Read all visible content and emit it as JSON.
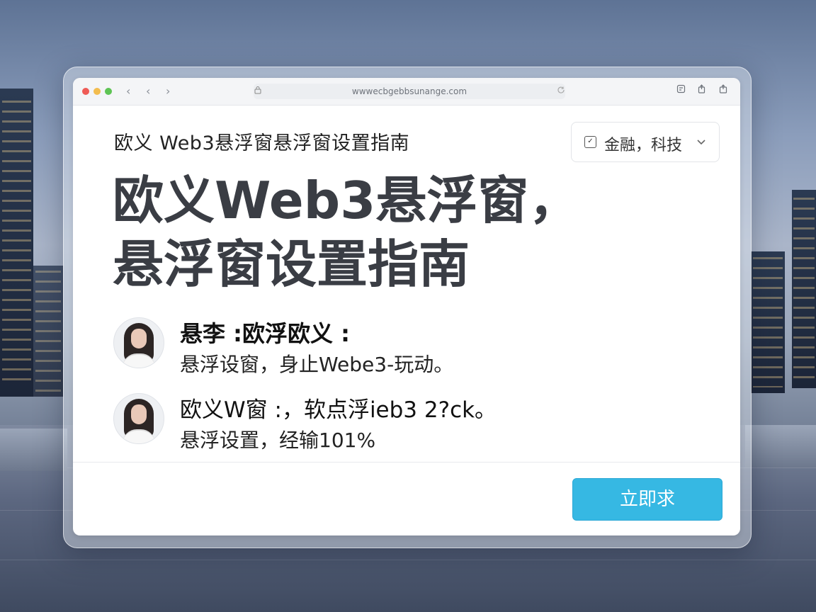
{
  "browser": {
    "url": "wwwecbgebbsunange.com",
    "nav": {
      "back": "‹",
      "back2": "‹",
      "forward": "›"
    }
  },
  "page": {
    "subtitle": "欧义 Web3悬浮窗悬浮窗设置指南",
    "category_label": "金融，科技",
    "headline_line1": "欧义Web3悬浮窗，",
    "headline_line2": "悬浮窗设置指南",
    "items": [
      {
        "title": "悬李 :欧浮欧义 :",
        "desc": "悬浮设窗，身止Webe3-玩动。"
      },
      {
        "title": "欧义W窗 :，软点浮ieb3 2?ck。",
        "desc": "悬浮设置，经输101%"
      }
    ],
    "cta_label": "立即求"
  },
  "colors": {
    "cta": "#36b8e3",
    "headline": "#3a3d44"
  }
}
